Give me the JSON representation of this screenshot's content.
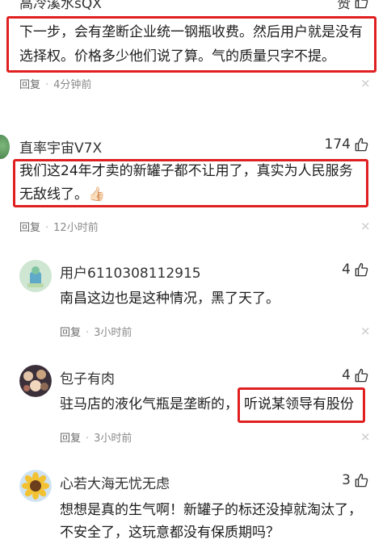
{
  "comments": [
    {
      "user": "高冷溪水sQX",
      "like_label": "赞",
      "text_line1": "下一步，会有垄断企业统一钢瓶收费。然后用户就是没有",
      "text_line2": "选择权。价格多少他们说了算。气的质量只字不提。",
      "reply_label": "回复",
      "time": "4分钟前"
    },
    {
      "user": "直率宇宙V7X",
      "likes": "174",
      "text_line1": "我们这24年才卖的新罐子都不让用了，真实为人民服务",
      "text_line2": "无敌线了。",
      "emoji": "👍🏻",
      "reply_label": "回复",
      "time": "12小时前"
    },
    {
      "user": "用户6110308112915",
      "likes": "4",
      "text": "南昌这边也是这种情况，黑了天了。",
      "reply_label": "回复",
      "time": "3小时前"
    },
    {
      "user": "包子有肉",
      "likes": "4",
      "text_prefix": "驻马店的液化气瓶是垄断的，",
      "text_highlight": "听说某领导有股份",
      "reply_label": "回复",
      "time": "3小时前"
    },
    {
      "user": "心若大海无忧无虑",
      "likes": "3",
      "text_line1": "想想是真的生气啊！新罐子的标还没掉就淘汰了，",
      "text_line2": "不安全了，这玩意都没有保质期吗？"
    }
  ],
  "close_symbol": "×",
  "separator": "·",
  "colors": {
    "highlight_border": "#e02020",
    "meta_text": "#8a8a8a"
  }
}
